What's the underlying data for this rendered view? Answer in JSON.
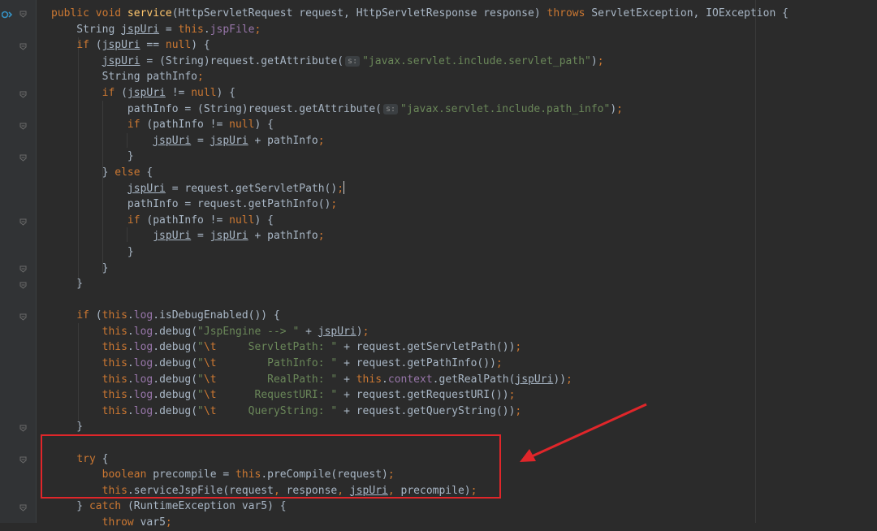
{
  "editor": {
    "lines": [
      "public void service(HttpServletRequest request, HttpServletResponse response) throws ServletException, IOException {",
      "String jspUri = this.jspFile;",
      "if (jspUri == null) {",
      "jspUri = (String)request.getAttribute( s: \"javax.servlet.include.servlet_path\");",
      "String pathInfo;",
      "if (jspUri != null) {",
      "pathInfo = (String)request.getAttribute( s: \"javax.servlet.include.path_info\");",
      "if (pathInfo != null) {",
      "jspUri = jspUri + pathInfo;",
      "}",
      "} else {",
      "jspUri = request.getServletPath();",
      "pathInfo = request.getPathInfo();",
      "if (pathInfo != null) {",
      "jspUri = jspUri + pathInfo;",
      "}",
      "}",
      "}",
      "",
      "if (this.log.isDebugEnabled()) {",
      "this.log.debug(\"JspEngine --> \" + jspUri);",
      "this.log.debug(\"\\t     ServletPath: \" + request.getServletPath());",
      "this.log.debug(\"\\t        PathInfo: \" + request.getPathInfo());",
      "this.log.debug(\"\\t        RealPath: \" + this.context.getRealPath(jspUri));",
      "this.log.debug(\"\\t      RequestURI: \" + request.getRequestURI());",
      "this.log.debug(\"\\t     QueryString: \" + request.getQueryString());",
      "}",
      "",
      "try {",
      "boolean precompile = this.preCompile(request);",
      "this.serviceJspFile(request, response, jspUri, precompile);",
      "} catch (RuntimeException var5) {",
      "throw var5;"
    ],
    "param_hint": "s:",
    "accent": "#e0262a"
  }
}
